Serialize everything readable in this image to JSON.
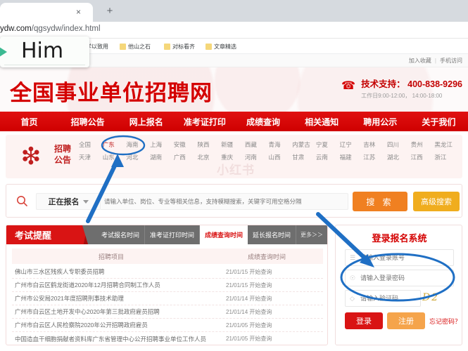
{
  "browser": {
    "tab_close_label": "×",
    "tab_new_label": "+",
    "url_domain": "ydw.com",
    "url_path": "/qgsydw/index.html",
    "bookmarks": [
      {
        "label": "学以致用"
      },
      {
        "label": "他山之石"
      },
      {
        "label": "对标看齐"
      },
      {
        "label": "文章精选"
      }
    ]
  },
  "overlay": {
    "label": "Him",
    "accent_color": "#3cba92"
  },
  "util_bar": {
    "favorite": "加入收藏",
    "separator": "|",
    "mobile": "手机访问"
  },
  "header": {
    "site_title": "全国事业单位招聘网",
    "support_label": "技术支持： 400-838-9296",
    "support_hours": "工作日9:00-12:00， 14:00-18:00",
    "brand_color": "#d40000"
  },
  "nav": {
    "items": [
      {
        "label": "首页"
      },
      {
        "label": "招聘公告"
      },
      {
        "label": "网上报名"
      },
      {
        "label": "准考证打印"
      },
      {
        "label": "成绩查询"
      },
      {
        "label": "相关通知"
      },
      {
        "label": "聘用公示"
      },
      {
        "label": "关于我们"
      }
    ]
  },
  "regions": {
    "panel_label_line1": "招聘",
    "panel_label_line2": "公告",
    "watermark": "小红书",
    "active": "广东",
    "items": [
      "全国",
      "广东",
      "海南",
      "上海",
      "安徽",
      "陕西",
      "新疆",
      "西藏",
      "青海",
      "内蒙古",
      "宁夏",
      "辽宁",
      "吉林",
      "四川",
      "贵州",
      "黑龙江",
      "天津",
      "山东",
      "河北",
      "湖南",
      "广西",
      "北京",
      "重庆",
      "河南",
      "山西",
      "甘肃",
      "云南",
      "福建",
      "江苏",
      "湖北",
      "江西",
      "浙江"
    ]
  },
  "search": {
    "selected_filter": "正在报名",
    "placeholder": "请输入单位、岗位、专业等相关信息，支持模糊搜索，关键字可用空格分隔",
    "value": "",
    "search_button": "搜 索",
    "advanced_button": "高级搜索",
    "search_color": "#f08021",
    "advanced_color": "#f0ad1e"
  },
  "exam_card": {
    "ribbon": "考试提醒",
    "tabs": [
      {
        "label": "考试报名时间",
        "active": false
      },
      {
        "label": "准考证打印时间",
        "active": false
      },
      {
        "label": "成绩查询时间",
        "active": true
      },
      {
        "label": "延长报名时间",
        "active": false
      }
    ],
    "more": "更多＞＞",
    "col_project": "招聘项目",
    "col_time": "成绩查询时间",
    "rows": [
      {
        "name": "佛山市三水区残疾人专职委员招聘",
        "date": "21/01/15",
        "status": "开始查询"
      },
      {
        "name": "广州市白云区鹤龙街道2020年12月招聘合同制工作人员",
        "date": "21/01/15",
        "status": "开始查询"
      },
      {
        "name": "广州市公安局2021年度招聘刑事技术助理",
        "date": "21/01/14",
        "status": "开始查询"
      },
      {
        "name": "广州市白云区土地开发中心2020年第三批政府雇员招聘",
        "date": "21/01/14",
        "status": "开始查询"
      },
      {
        "name": "广州市白云区人民检察院2020年公开招聘政府雇员",
        "date": "21/01/05",
        "status": "开始查询"
      },
      {
        "name": "中国造血干细胞捐献者资料库广东省管理中心公开招聘事业单位工作人员",
        "date": "21/01/05",
        "status": "开始查询"
      }
    ]
  },
  "login": {
    "title": "登录报名系统",
    "account_placeholder": "请输入登录账号",
    "password_placeholder": "请输入登录密码",
    "captcha_placeholder": "请输入验证码",
    "captcha_value": "D2",
    "login_button": "登录",
    "register_button": "注册",
    "forgot_link": "忘记密码？",
    "login_color": "#d91414",
    "register_color": "#f5a44b"
  },
  "annotations": {
    "color": "#1f6fc4",
    "marks": [
      "ellipse-guangdong-region",
      "arrow-to-region-filter",
      "arrow-to-login-account",
      "ellipse-login-credentials"
    ]
  }
}
